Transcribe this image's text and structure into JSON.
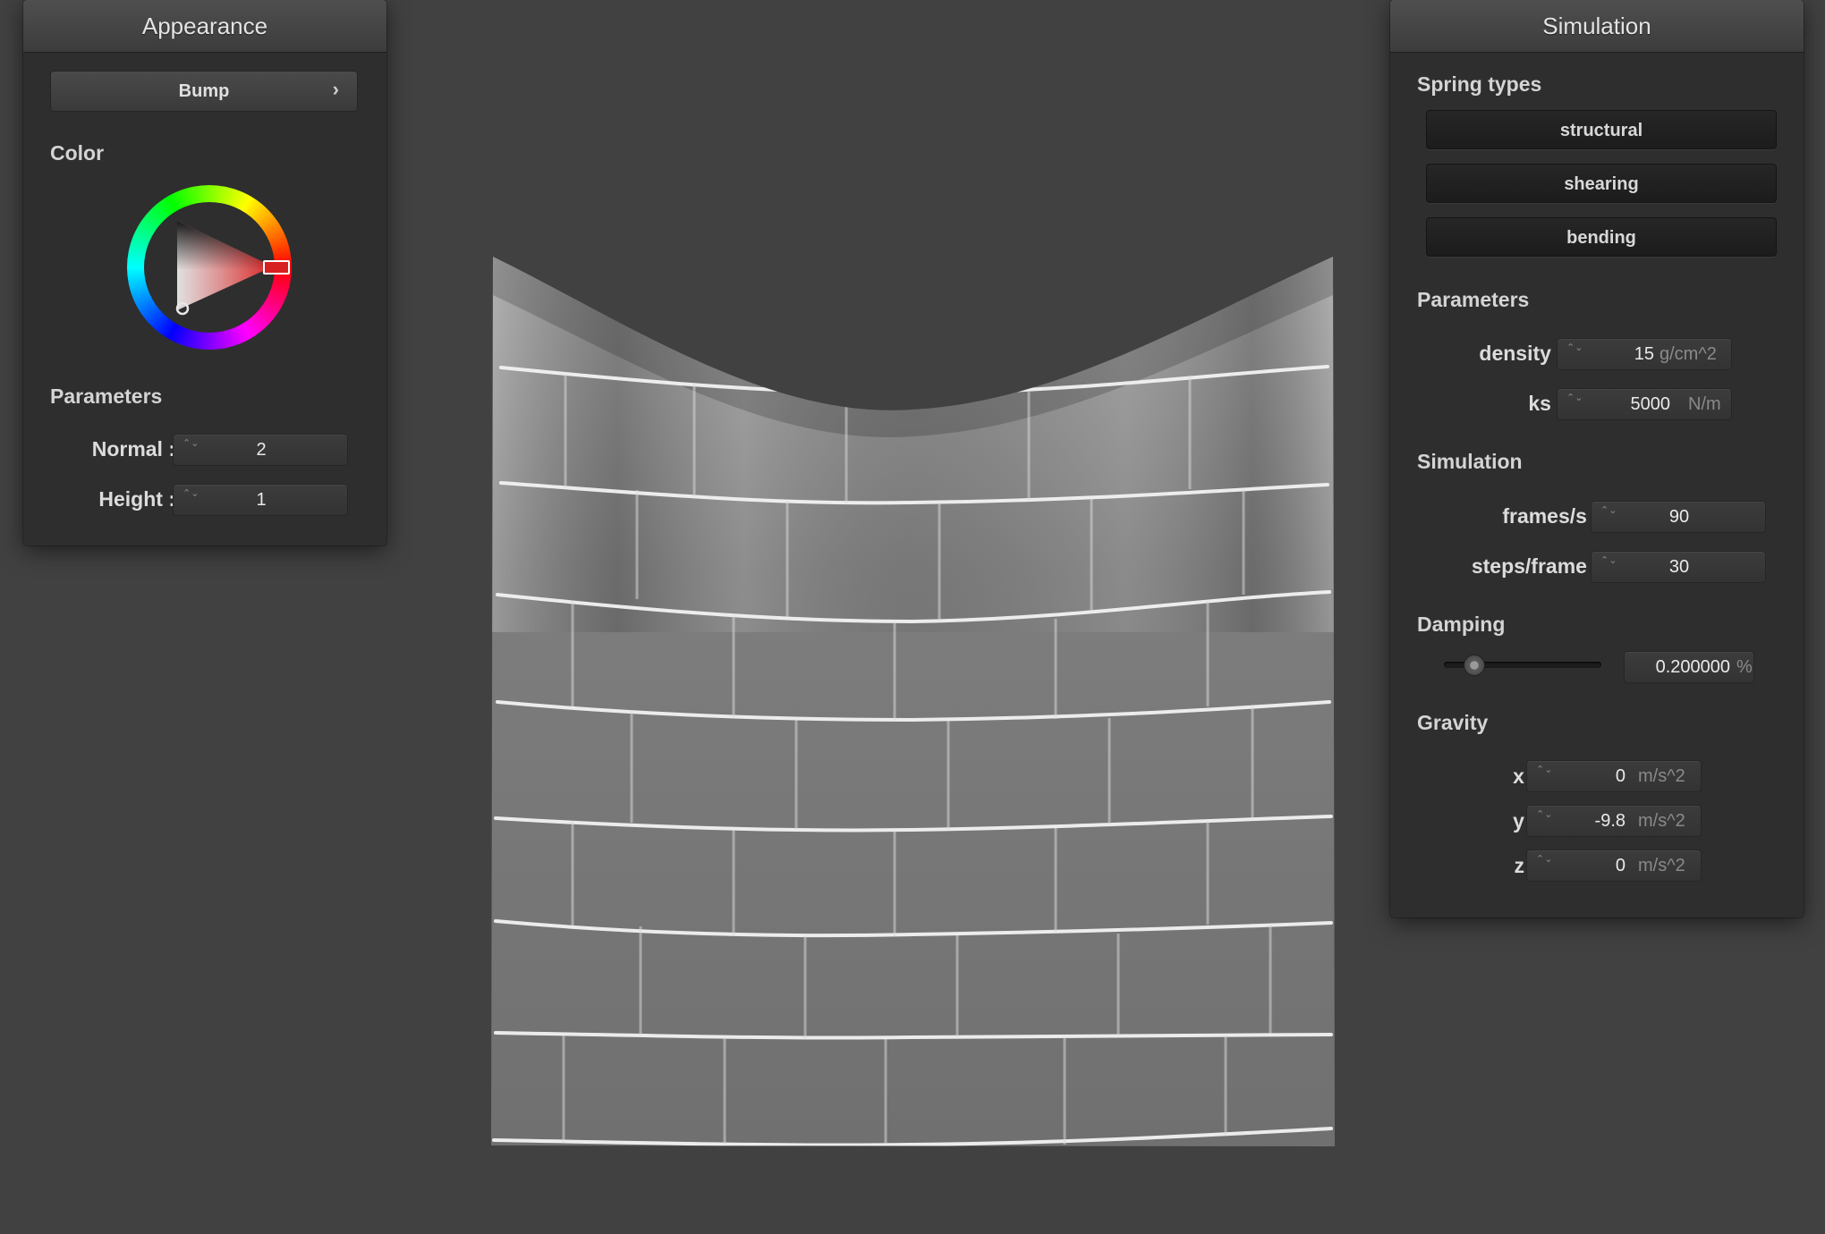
{
  "appearance": {
    "title": "Appearance",
    "shader_button": "Bump",
    "shader_chevron": "›",
    "color_label": "Color",
    "color_value": "#d82020",
    "parameters_label": "Parameters",
    "normal": {
      "label": "Normal :",
      "value": "2"
    },
    "height": {
      "label": "Height :",
      "value": "1"
    }
  },
  "simulation": {
    "title": "Simulation",
    "spring_types_label": "Spring types",
    "springs": [
      "structural",
      "shearing",
      "bending"
    ],
    "parameters_label": "Parameters",
    "density": {
      "label": "density :",
      "value": "15",
      "unit": "g/cm^2"
    },
    "ks": {
      "label": "ks :",
      "value": "5000",
      "unit": "N/m"
    },
    "simulation_label": "Simulation",
    "frames": {
      "label": "frames/s :",
      "value": "90"
    },
    "steps": {
      "label": "steps/frame :",
      "value": "30"
    },
    "damping_label": "Damping",
    "damping": {
      "value": "0.200000",
      "unit": "%",
      "slider_fraction": 0.2
    },
    "gravity_label": "Gravity",
    "gx": {
      "label": "x :",
      "value": "0",
      "unit": "m/s^2"
    },
    "gy": {
      "label": "y :",
      "value": "-9.8",
      "unit": "m/s^2"
    },
    "gz": {
      "label": "z :",
      "value": "0",
      "unit": "m/s^2"
    }
  },
  "spinner_glyph": "⌃⌄",
  "colors": {
    "background": "#414141",
    "panel": "#2e2e2e",
    "accent": "#d82020",
    "cloth": "#808080"
  }
}
